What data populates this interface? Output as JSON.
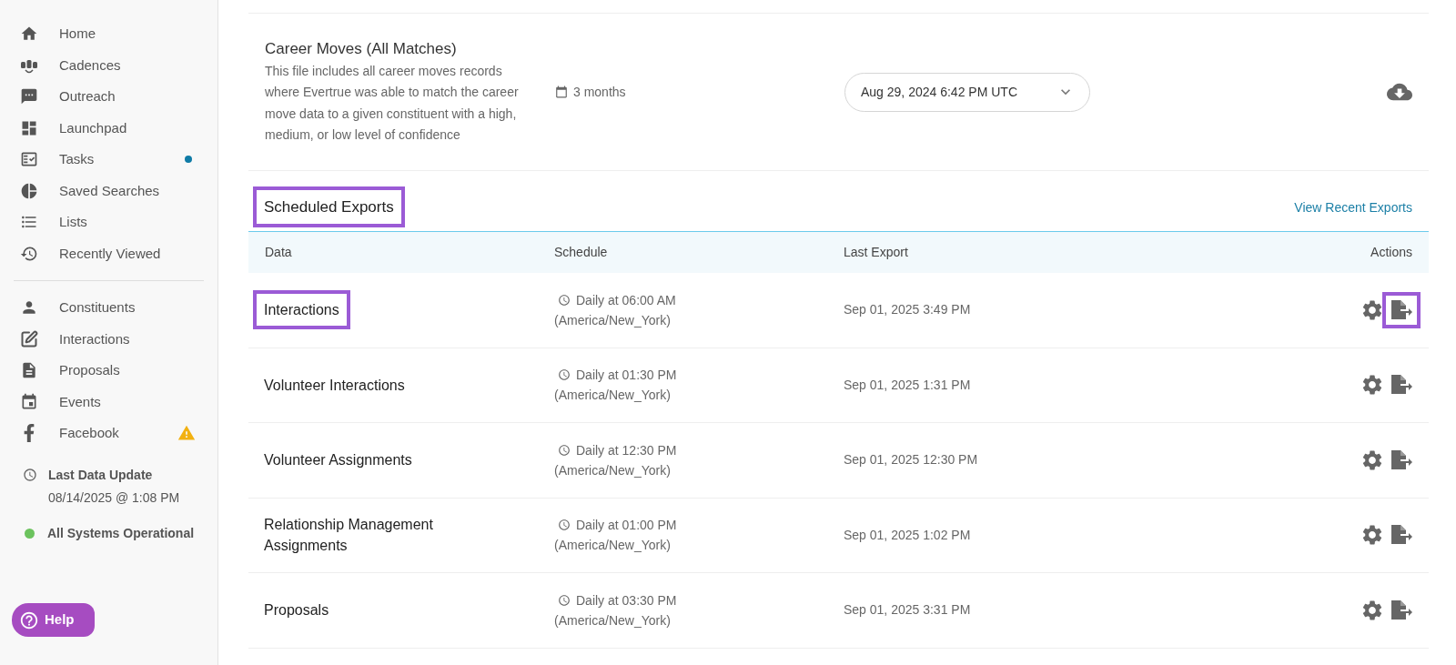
{
  "sidebar": {
    "primary_items": [
      {
        "label": "Home"
      },
      {
        "label": "Cadences"
      },
      {
        "label": "Outreach"
      },
      {
        "label": "Launchpad"
      },
      {
        "label": "Tasks",
        "unread_dot": true
      },
      {
        "label": "Saved Searches"
      },
      {
        "label": "Lists"
      },
      {
        "label": "Recently Viewed"
      }
    ],
    "secondary_items": [
      {
        "label": "Constituents"
      },
      {
        "label": "Interactions"
      },
      {
        "label": "Proposals"
      },
      {
        "label": "Events"
      },
      {
        "label": "Facebook",
        "warning": true
      }
    ],
    "last_update": {
      "title": "Last Data Update",
      "value": "08/14/2025 @ 1:08 PM"
    },
    "system_status": {
      "label": "All Systems Operational",
      "color": "#6cc35e"
    },
    "help_button": "Help"
  },
  "file_export": {
    "title": "Career Moves (All Matches)",
    "description": "This file includes all career moves records where Evertrue was able to match the career move data to a given constituent with a high, medium, or low level of confidence",
    "period": "3 months",
    "date_select": "Aug 29, 2024 6:42 PM UTC"
  },
  "scheduled_exports": {
    "title": "Scheduled Exports",
    "title_highlighted": true,
    "link": "View Recent Exports",
    "columns": [
      "Data",
      "Schedule",
      "Last Export",
      "Actions"
    ],
    "rows": [
      {
        "data": "Interactions",
        "data_highlighted": true,
        "schedule": "Daily at 06:00 AM",
        "timezone": "(America/New_York)",
        "last_export": "Sep 01, 2025 3:49 PM",
        "export_highlighted": true
      },
      {
        "data": "Volunteer Interactions",
        "data_highlighted": false,
        "schedule": "Daily at 01:30 PM",
        "timezone": "(America/New_York)",
        "last_export": "Sep 01, 2025 1:31 PM",
        "export_highlighted": false
      },
      {
        "data": "Volunteer Assignments",
        "data_highlighted": false,
        "schedule": "Daily at 12:30 PM",
        "timezone": "(America/New_York)",
        "last_export": "Sep 01, 2025 12:30 PM",
        "export_highlighted": false
      },
      {
        "data": "Relationship Management Assignments",
        "data_highlighted": false,
        "schedule": "Daily at 01:00 PM",
        "timezone": "(America/New_York)",
        "last_export": "Sep 01, 2025 1:02 PM",
        "export_highlighted": false
      },
      {
        "data": "Proposals",
        "data_highlighted": false,
        "schedule": "Daily at 03:30 PM",
        "timezone": "(America/New_York)",
        "last_export": "Sep 01, 2025 3:31 PM",
        "export_highlighted": false
      }
    ]
  }
}
